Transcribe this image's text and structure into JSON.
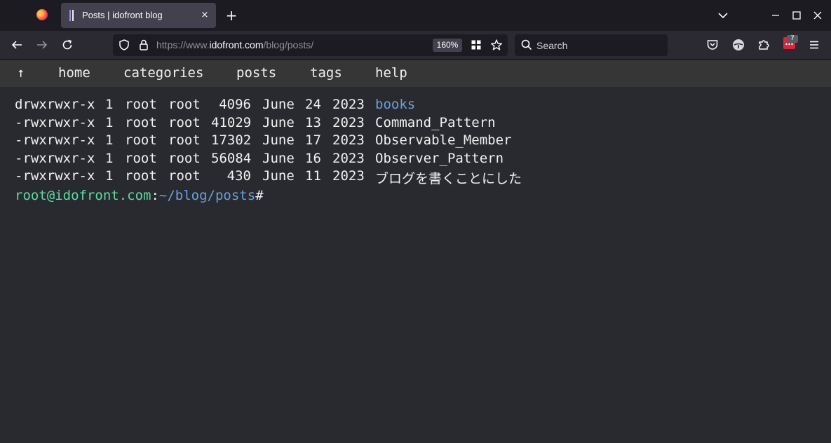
{
  "browser": {
    "tab_title": "Posts | idofront blog",
    "tab_close": "×",
    "new_tab": "+",
    "url_prefix": "https://www.",
    "url_host": "idofront.com",
    "url_path": "/blog/posts/",
    "zoom": "160%",
    "search_placeholder": "Search",
    "extension_count": "7",
    "accent": "#d7263d"
  },
  "site_nav": {
    "up": "↑",
    "home": "home",
    "categories": "categories",
    "posts": "posts",
    "tags": "tags",
    "help": "help"
  },
  "listing": [
    {
      "perm": "drwxrwxr-x",
      "links": "1",
      "owner": "root",
      "group": "root",
      "size": "4096",
      "month": "June",
      "day": "24",
      "year": "2023",
      "name": "books",
      "is_dir": true
    },
    {
      "perm": "-rwxrwxr-x",
      "links": "1",
      "owner": "root",
      "group": "root",
      "size": "41029",
      "month": "June",
      "day": "13",
      "year": "2023",
      "name": "Command_Pattern",
      "is_dir": false
    },
    {
      "perm": "-rwxrwxr-x",
      "links": "1",
      "owner": "root",
      "group": "root",
      "size": "17302",
      "month": "June",
      "day": "17",
      "year": "2023",
      "name": "Observable_Member",
      "is_dir": false
    },
    {
      "perm": "-rwxrwxr-x",
      "links": "1",
      "owner": "root",
      "group": "root",
      "size": "56084",
      "month": "June",
      "day": "16",
      "year": "2023",
      "name": "Observer_Pattern",
      "is_dir": false
    },
    {
      "perm": "-rwxrwxr-x",
      "links": "1",
      "owner": "root",
      "group": "root",
      "size": "430",
      "month": "June",
      "day": "11",
      "year": "2023",
      "name": "ブログを書くことにした",
      "is_dir": false
    }
  ],
  "prompt": {
    "user": "root@idofront.com",
    "colon": ":",
    "path": "~/blog/posts",
    "symbol": "#"
  }
}
